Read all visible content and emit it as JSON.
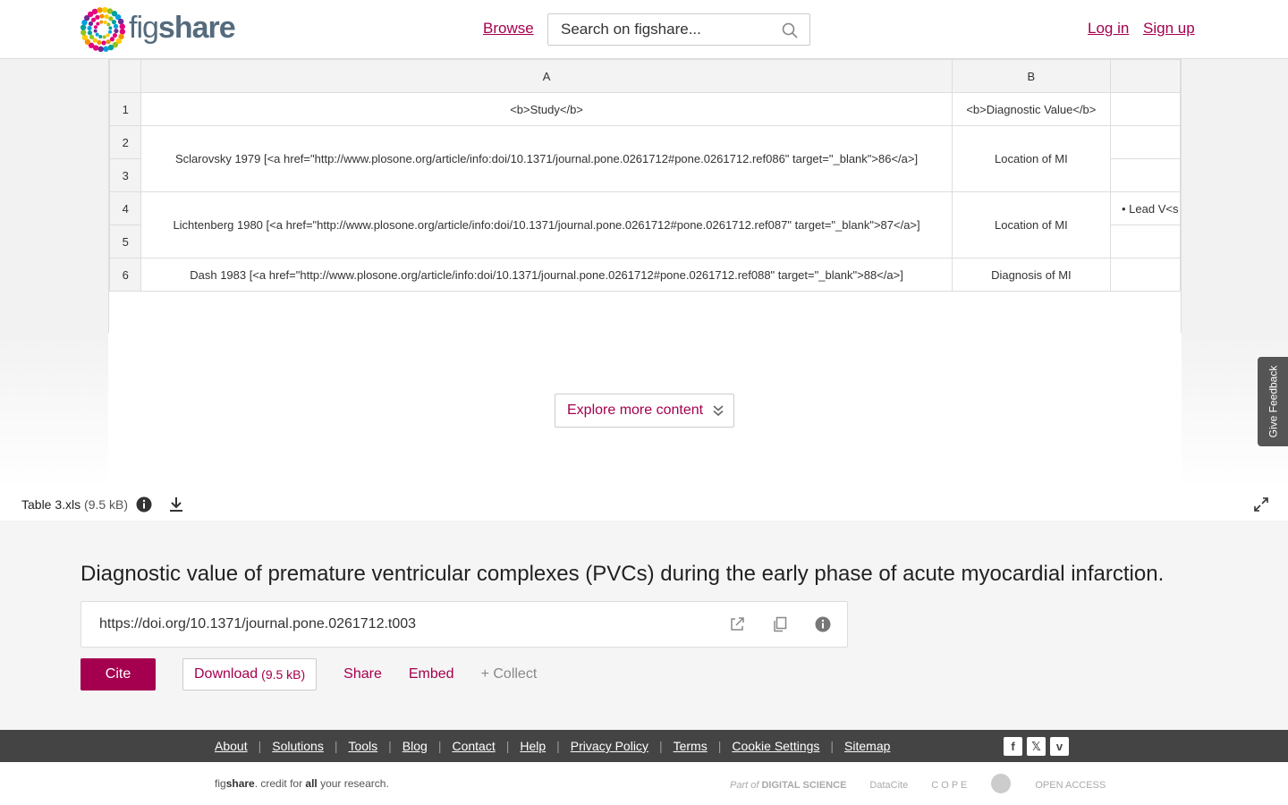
{
  "header": {
    "logo_fig": "fig",
    "logo_share": "share",
    "browse": "Browse",
    "search_placeholder": "Search on figshare...",
    "login": "Log in",
    "signup": "Sign up"
  },
  "sheet": {
    "col_a": "A",
    "col_b": "B",
    "rownums": [
      "1",
      "2",
      "3",
      "4",
      "5",
      "6"
    ],
    "row1_a": "<b>Study</b>",
    "row1_b": "<b>Diagnostic Value</b>",
    "row2_a": "Sclarovsky 1979 [<a href=\"http://www.plosone.org/article/info:doi/10.1371/journal.pone.0261712#pone.0261712.ref086\" target=\"_blank\">86</a>]",
    "row2_b": "Location of MI",
    "row4_a": "Lichtenberg 1980 [<a href=\"http://www.plosone.org/article/info:doi/10.1371/journal.pone.0261712#pone.0261712.ref087\" target=\"_blank\">87</a>]",
    "row4_b": "Location of MI",
    "row4_c": "• Lead V<s",
    "row6_a": "Dash 1983 [<a href=\"http://www.plosone.org/article/info:doi/10.1371/journal.pone.0261712#pone.0261712.ref088\" target=\"_blank\">88</a>]",
    "row6_b": "Diagnosis of MI"
  },
  "viewer": {
    "explore": "Explore more content",
    "feedback": "Give Feedback"
  },
  "file": {
    "name": "Table 3.xls",
    "size": "(9.5 kB)"
  },
  "meta": {
    "title": "Diagnostic value of premature ventricular complexes (PVCs) during the early phase of acute myocardial infarction.",
    "doi": "https://doi.org/10.1371/journal.pone.0261712.t003",
    "cite": "Cite",
    "download": "Download",
    "download_size": "(9.5 kB)",
    "share": "Share",
    "embed": "Embed",
    "collect": "+ Collect"
  },
  "footer": {
    "links": [
      "About",
      "Solutions",
      "Tools",
      "Blog",
      "Contact",
      "Help",
      "Privacy Policy",
      "Terms",
      "Cookie Settings",
      "Sitemap"
    ],
    "tag_fig": "fig",
    "tag_share": "share",
    "tag_mid": ". credit for ",
    "tag_all": "all",
    "tag_end": " your research.",
    "partner_ds_pre": "Part of",
    "partner_ds": "DIGITAL SCIENCE",
    "partner_datacite": "DataCite",
    "partner_cope": "C O P E",
    "partner_oa": "OPEN ACCESS"
  },
  "colors": {
    "accent": "#a5004f",
    "footer_bg": "#444444"
  }
}
